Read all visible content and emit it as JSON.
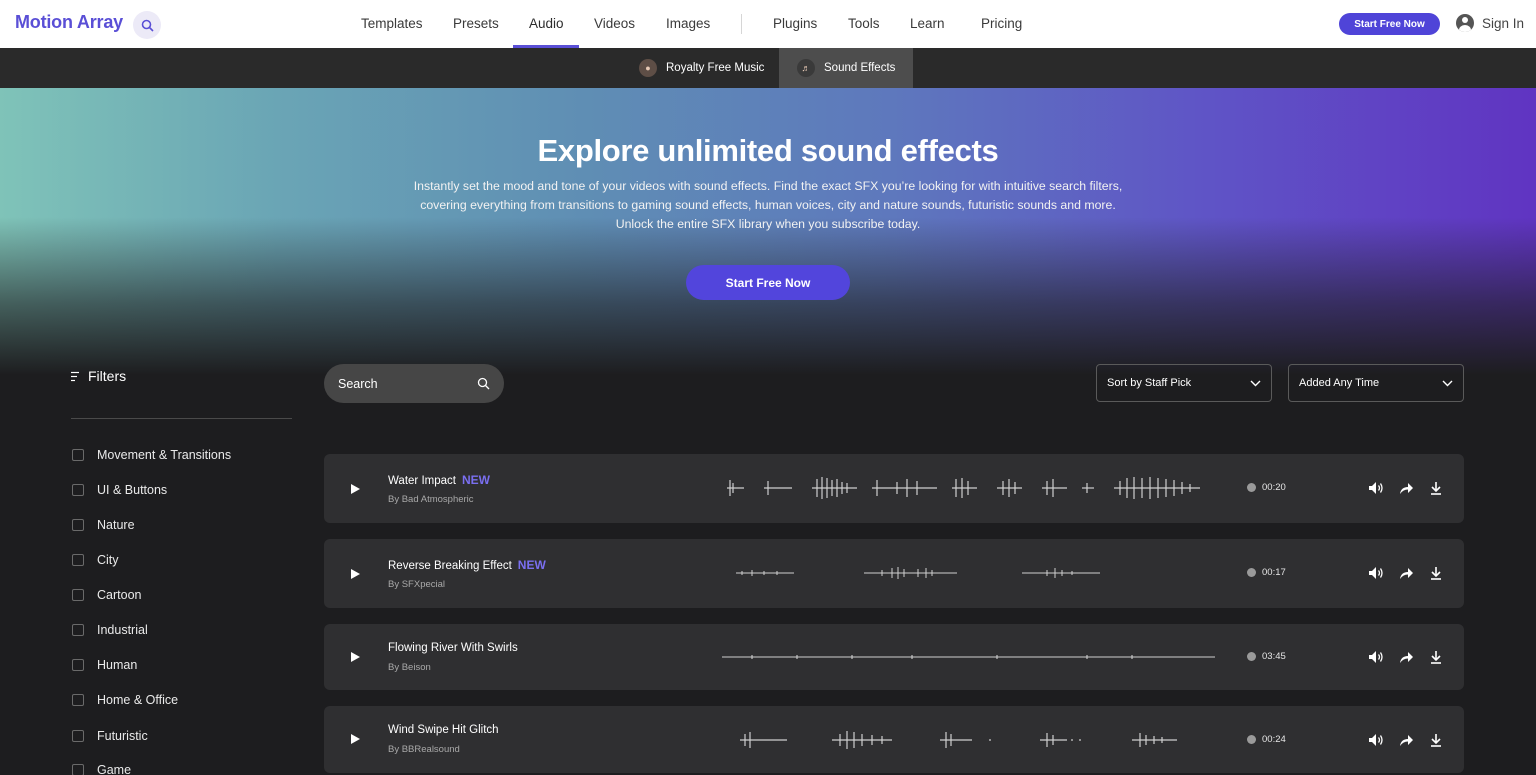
{
  "brand": {
    "name": "Motion Array"
  },
  "nav": {
    "items": [
      "Templates",
      "Presets",
      "Audio",
      "Videos",
      "Images",
      "Plugins",
      "Tools",
      "Learn",
      "Pricing"
    ],
    "active": "Audio",
    "cta": "Start Free Now",
    "signin": "Sign In"
  },
  "subnav": {
    "tabs": [
      "Royalty Free Music",
      "Sound Effects"
    ],
    "active": "Sound Effects"
  },
  "hero": {
    "title": "Explore unlimited sound effects",
    "description": "Instantly set the mood and tone of your videos with sound effects. Find the exact SFX you’re looking for with intuitive search filters, covering everything from transitions to gaming sound effects, human voices, city and nature sounds, futuristic sounds and more. Unlock the entire SFX library when you subscribe today.",
    "cta": "Start Free Now"
  },
  "filters": {
    "title": "Filters",
    "items": [
      "Movement & Transitions",
      "UI & Buttons",
      "Nature",
      "City",
      "Cartoon",
      "Industrial",
      "Human",
      "Home & Office",
      "Futuristic",
      "Game"
    ]
  },
  "controls": {
    "search_placeholder": "Search",
    "sort": "Sort by Staff Pick",
    "time": "Added Any Time"
  },
  "tracks": [
    {
      "title": "Water Impact",
      "badge": "NEW",
      "author": "By Bad Atmospheric",
      "duration": "00:20"
    },
    {
      "title": "Reverse Breaking Effect",
      "badge": "NEW",
      "author": "By SFXpecial",
      "duration": "00:17"
    },
    {
      "title": "Flowing River With Swirls",
      "badge": "",
      "author": "By Beison",
      "duration": "03:45"
    },
    {
      "title": "Wind Swipe Hit Glitch",
      "badge": "",
      "author": "By BBRealsound",
      "duration": "00:24"
    }
  ],
  "colors": {
    "accent": "#5245dc",
    "background": "#1d1d1f",
    "row": "#2f2f31",
    "new_badge": "#7a6ff0"
  }
}
